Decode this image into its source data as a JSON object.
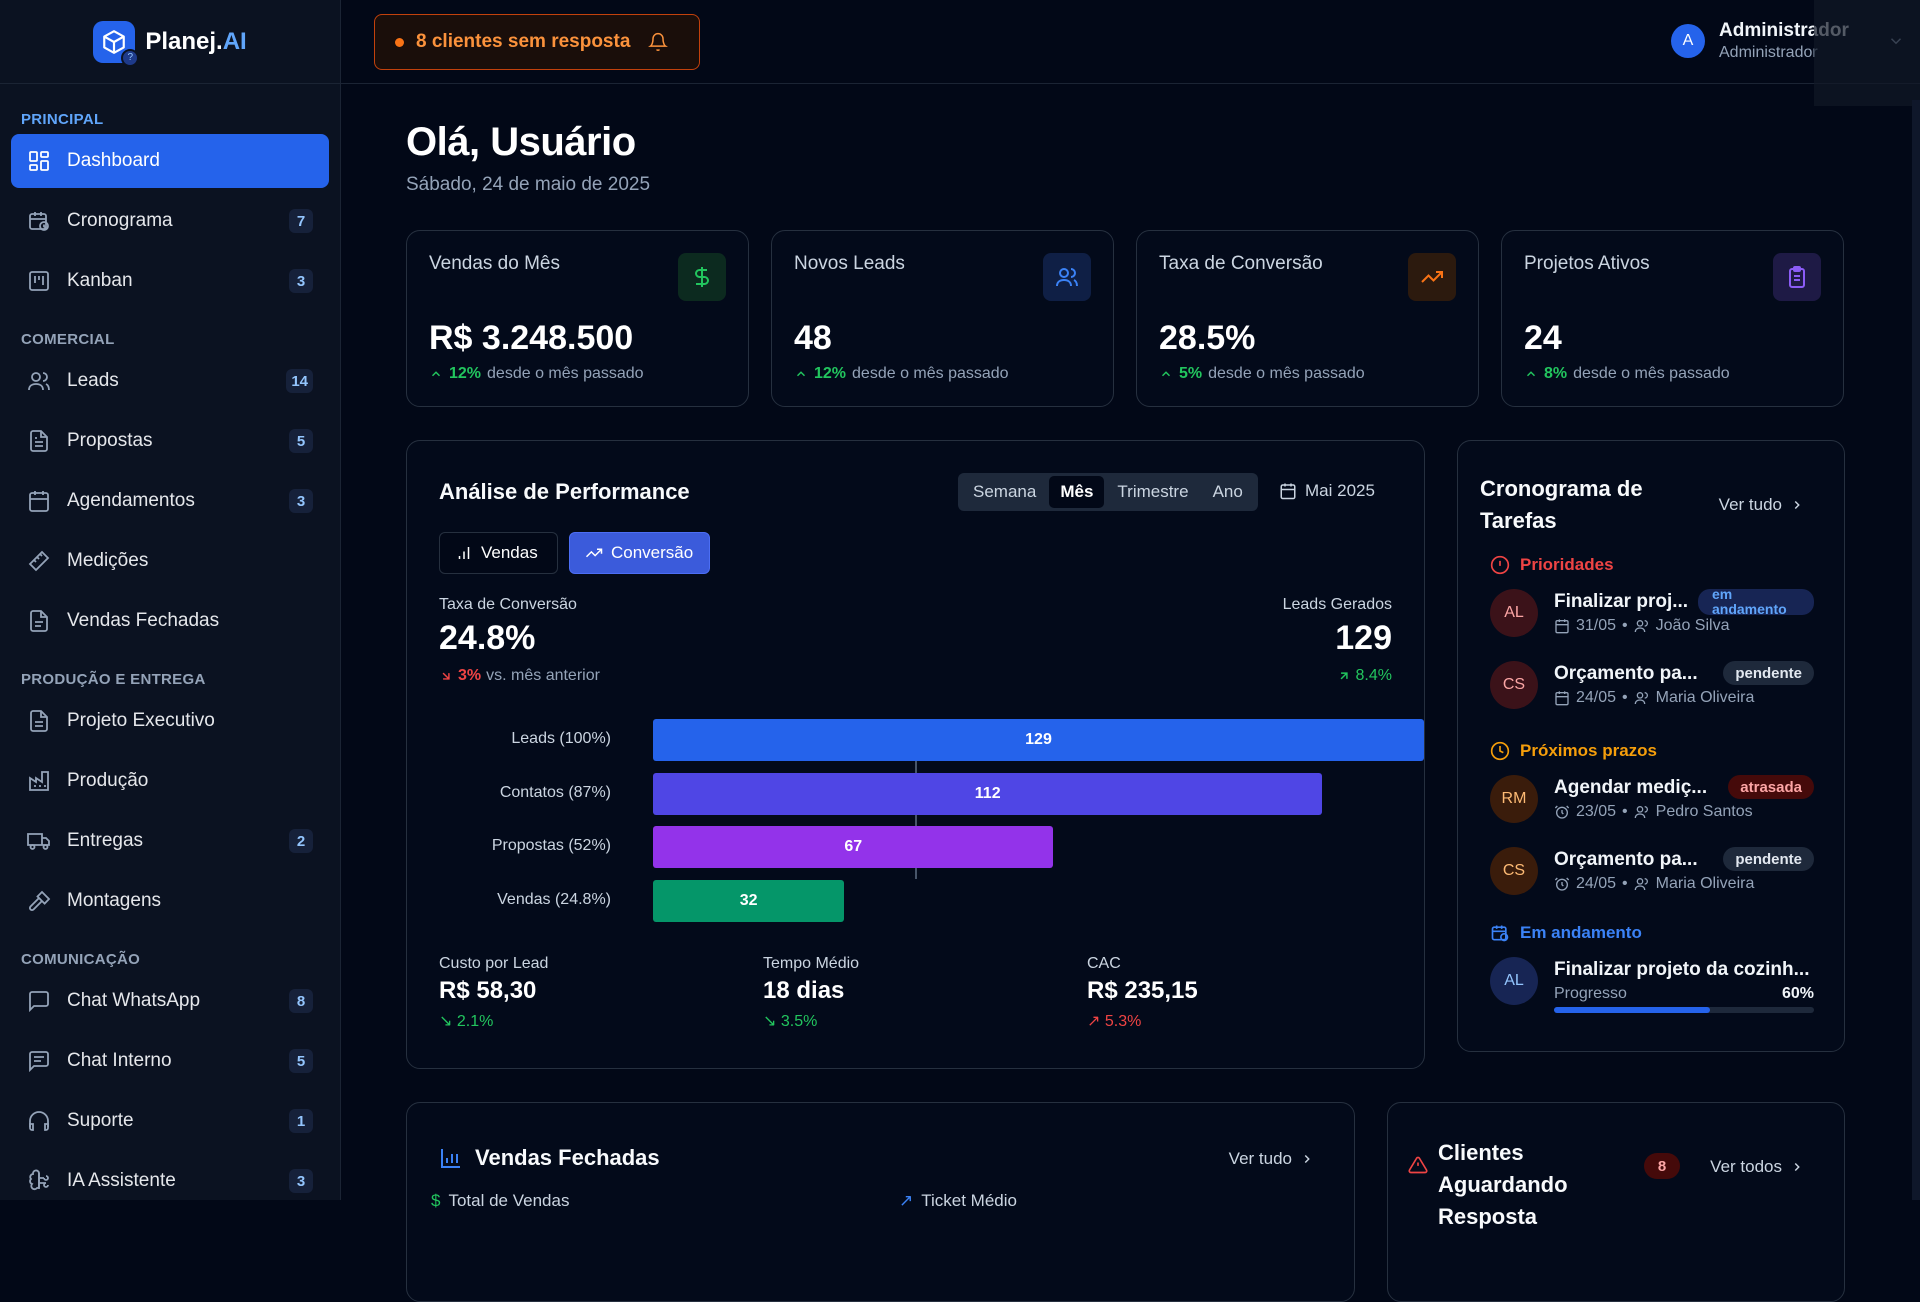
{
  "app": {
    "brand": "Planej.",
    "brand_accent": "AI"
  },
  "sidebar": {
    "sections": [
      {
        "title": "PRINCIPAL",
        "items": [
          {
            "label": "Dashboard",
            "badge": "",
            "icon": "dashboard-icon",
            "active": true
          },
          {
            "label": "Cronograma",
            "badge": "7",
            "icon": "calendar-clock-icon"
          },
          {
            "label": "Kanban",
            "badge": "3",
            "icon": "kanban-icon"
          }
        ]
      },
      {
        "title": "COMERCIAL",
        "items": [
          {
            "label": "Leads",
            "badge": "14",
            "icon": "users-icon"
          },
          {
            "label": "Propostas",
            "badge": "5",
            "icon": "file-text-icon"
          },
          {
            "label": "Agendamentos",
            "badge": "3",
            "icon": "calendar-icon"
          },
          {
            "label": "Medições",
            "badge": "",
            "icon": "ruler-icon"
          },
          {
            "label": "Vendas Fechadas",
            "badge": "",
            "icon": "file-check-icon"
          }
        ]
      },
      {
        "title": "PRODUÇÃO E ENTREGA",
        "items": [
          {
            "label": "Projeto Executivo",
            "badge": "",
            "icon": "file-icon"
          },
          {
            "label": "Produção",
            "badge": "",
            "icon": "factory-icon"
          },
          {
            "label": "Entregas",
            "badge": "2",
            "icon": "truck-icon"
          },
          {
            "label": "Montagens",
            "badge": "",
            "icon": "hammer-icon"
          }
        ]
      },
      {
        "title": "COMUNICAÇÃO",
        "items": [
          {
            "label": "Chat WhatsApp",
            "badge": "8",
            "icon": "message-icon"
          },
          {
            "label": "Chat Interno",
            "badge": "5",
            "icon": "message-lines-icon"
          },
          {
            "label": "Suporte",
            "badge": "1",
            "icon": "headset-icon"
          },
          {
            "label": "IA Assistente",
            "badge": "3",
            "icon": "brain-icon"
          }
        ]
      }
    ]
  },
  "topbar": {
    "alert": "8 clientes sem resposta",
    "user_initial": "A",
    "user_name": "Administrador",
    "user_role": "Administrador"
  },
  "main": {
    "greeting": "Olá, Usuário",
    "date": "Sábado, 24 de maio de 2025",
    "stats": [
      {
        "title": "Vendas do Mês",
        "value": "R$ 3.248.500",
        "delta": "12%",
        "delta_text": "desde o mês passado",
        "icon": "dollar-icon",
        "color": "#22c55e"
      },
      {
        "title": "Novos Leads",
        "value": "48",
        "delta": "12%",
        "delta_text": "desde o mês passado",
        "icon": "users-icon",
        "color": "#3b82f6"
      },
      {
        "title": "Taxa de Conversão",
        "value": "28.5%",
        "delta": "5%",
        "delta_text": "desde o mês passado",
        "icon": "trending-up-icon",
        "color": "#f97316"
      },
      {
        "title": "Projetos Ativos",
        "value": "24",
        "delta": "8%",
        "delta_text": "desde o mês passado",
        "icon": "clipboard-icon",
        "color": "#8b5cf6"
      }
    ]
  },
  "performance": {
    "title": "Análise de Performance",
    "periods": [
      "Semana",
      "Mês",
      "Trimestre",
      "Ano"
    ],
    "selected_period": "Mês",
    "month": "Mai 2025",
    "tabs": [
      "Vendas",
      "Conversão"
    ],
    "active_tab": "Conversão",
    "conv_label": "Taxa de Conversão",
    "conv_value": "24.8%",
    "conv_delta": "3%",
    "conv_delta_text": "vs. mês anterior",
    "leads_label": "Leads Gerados",
    "leads_value": "129",
    "leads_delta": "8.4%",
    "metrics": [
      {
        "label": "Custo por Lead",
        "value": "R$ 58,30",
        "delta": "2.1%",
        "trend": "down-good"
      },
      {
        "label": "Tempo Médio",
        "value": "18 dias",
        "delta": "3.5%",
        "trend": "down-good"
      },
      {
        "label": "CAC",
        "value": "R$ 235,15",
        "delta": "5.3%",
        "trend": "up-bad"
      }
    ]
  },
  "chart_data": {
    "type": "bar",
    "orientation": "horizontal",
    "categories": [
      "Leads (100%)",
      "Contatos (87%)",
      "Propostas (52%)",
      "Vendas (24.8%)"
    ],
    "values": [
      129,
      112,
      67,
      32
    ],
    "colors": [
      "#2563eb",
      "#4f46e5",
      "#9333ea",
      "#059669"
    ],
    "xlim": [
      0,
      129
    ]
  },
  "schedule": {
    "title": "Cronograma de Tarefas",
    "see_all": "Ver tudo",
    "groups": {
      "priorities": "Prioridades",
      "upcoming": "Próximos prazos",
      "in_progress": "Em andamento"
    },
    "tasks": [
      {
        "initials": "AL",
        "title": "Finalizar proj...",
        "date": "31/05",
        "person": "João Silva",
        "status": "em andamento"
      },
      {
        "initials": "CS",
        "title": "Orçamento pa...",
        "date": "24/05",
        "person": "Maria Oliveira",
        "status": "pendente"
      },
      {
        "initials": "RM",
        "title": "Agendar mediç...",
        "date": "23/05",
        "person": "Pedro Santos",
        "status": "atrasada"
      },
      {
        "initials": "CS",
        "title": "Orçamento pa...",
        "date": "24/05",
        "person": "Maria Oliveira",
        "status": "pendente"
      }
    ],
    "progress_task": {
      "initials": "AL",
      "title": "Finalizar projeto da cozinh...",
      "label": "Progresso",
      "percent": "60%",
      "value": 0.6
    }
  },
  "vendas_fechadas": {
    "title": "Vendas Fechadas",
    "see_all": "Ver tudo",
    "col1": "Total de Vendas",
    "col2": "Ticket Médio"
  },
  "clientes": {
    "title": "Clientes Aguardando Resposta",
    "count": "8",
    "see_all": "Ver todos"
  }
}
